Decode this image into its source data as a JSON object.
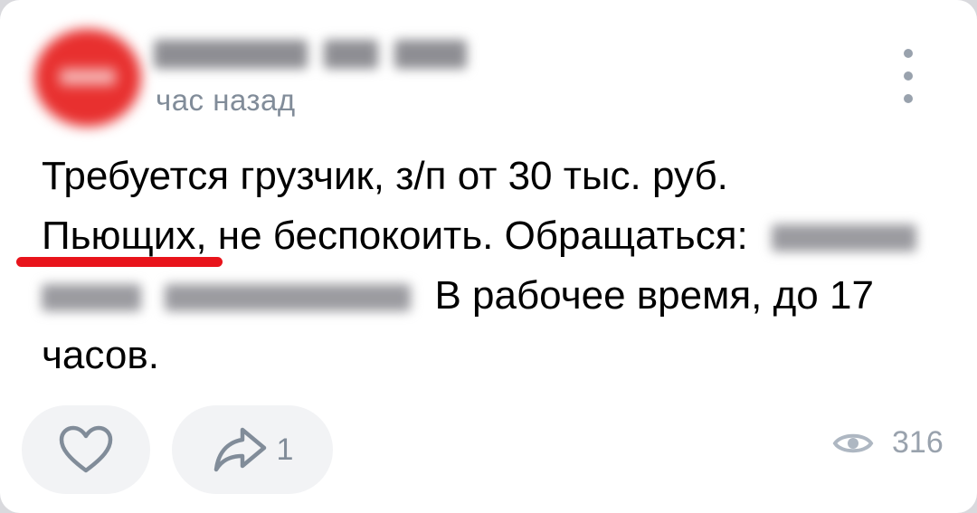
{
  "post": {
    "timestamp": "час назад",
    "text": {
      "line1": "Требуется грузчик, з/п от 30 тыс. руб.",
      "line2": "Пьющих, не беспокоить. Обращаться:",
      "line3": "В рабочее время, до 17",
      "line4": "часов."
    }
  },
  "footer": {
    "share_count": "1",
    "views_count": "316"
  },
  "icons": {
    "more": "more-vertical-icon",
    "like": "heart-icon",
    "share": "share-arrow-icon",
    "views": "eye-icon"
  },
  "colors": {
    "accent_red": "#e8141b",
    "avatar_red": "#e8302f",
    "muted_text": "#818c99",
    "button_bg": "#f2f3f5"
  }
}
